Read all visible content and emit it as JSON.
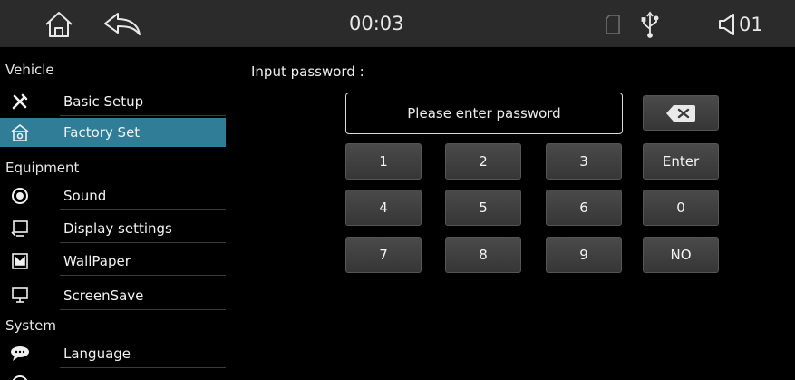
{
  "status_bar": {
    "time": "00:03",
    "volume_level": "01",
    "icons": [
      "home-icon",
      "back-icon",
      "sd-card-icon",
      "usb-icon",
      "volume-icon"
    ]
  },
  "sidebar": {
    "sections": [
      {
        "header": "Vehicle",
        "items": [
          {
            "label": "Basic Setup",
            "icon": "tools-icon",
            "active": false
          },
          {
            "label": "Factory Set",
            "icon": "factory-icon",
            "active": true
          }
        ]
      },
      {
        "header": "Equipment",
        "items": [
          {
            "label": "Sound",
            "icon": "sound-icon",
            "active": false
          },
          {
            "label": "Display settings",
            "icon": "display-icon",
            "active": false
          },
          {
            "label": "WallPaper",
            "icon": "wallpaper-icon",
            "active": false
          },
          {
            "label": "ScreenSave",
            "icon": "monitor-icon",
            "active": false
          }
        ]
      },
      {
        "header": "System",
        "items": [
          {
            "label": "Language",
            "icon": "speech-bubble-icon",
            "active": false
          }
        ]
      }
    ]
  },
  "main": {
    "prompt": "Input password :",
    "password_field": {
      "placeholder": "Please enter password",
      "value": ""
    },
    "keypad": {
      "row1": [
        "1",
        "2",
        "3",
        "Enter"
      ],
      "row2": [
        "4",
        "5",
        "6",
        "0"
      ],
      "row3": [
        "7",
        "8",
        "9",
        "NO"
      ]
    }
  },
  "colors": {
    "status_bar_bg": "#2b2b2b",
    "active_item_bg": "#2f7d97",
    "key_bg": "#3f3f3f",
    "background": "#000000"
  }
}
